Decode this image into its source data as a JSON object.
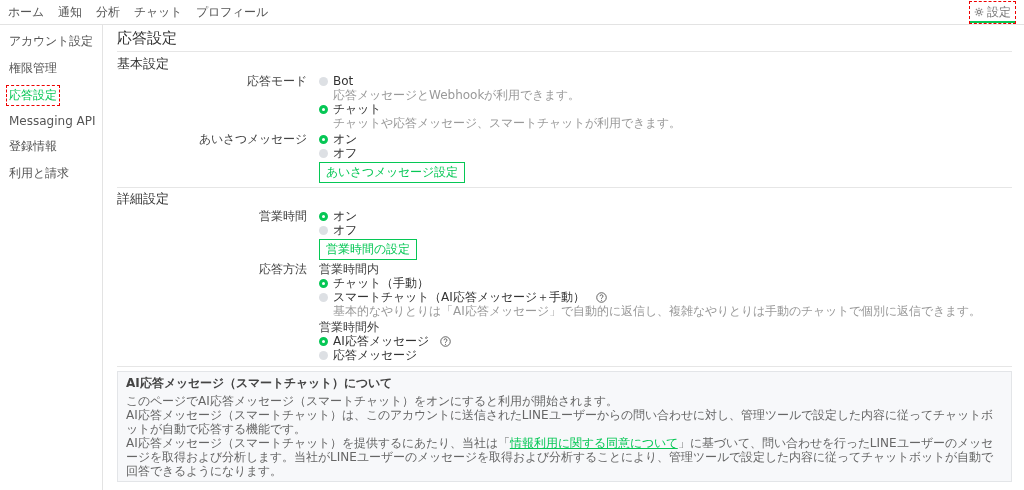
{
  "nav": {
    "items": [
      {
        "label": "ホーム",
        "selected": false
      },
      {
        "label": "通知",
        "selected": false
      },
      {
        "label": "分析",
        "selected": false
      },
      {
        "label": "チャット",
        "selected": false
      },
      {
        "label": "プロフィール",
        "selected": false
      }
    ],
    "settings": {
      "label": "設定",
      "selected": true,
      "annotated": true
    }
  },
  "sidebar": {
    "items": [
      {
        "label": "アカウント設定",
        "selected": false,
        "annotated": false
      },
      {
        "label": "権限管理",
        "selected": false,
        "annotated": false
      },
      {
        "label": "応答設定",
        "selected": true,
        "annotated": true
      },
      {
        "label": "Messaging API",
        "selected": false,
        "annotated": false
      },
      {
        "label": "登録情報",
        "selected": false,
        "annotated": false
      },
      {
        "label": "利用と請求",
        "selected": false,
        "annotated": false
      }
    ]
  },
  "page_title": "応答設定",
  "sections": [
    {
      "title": "基本設定",
      "fields": [
        {
          "label": "応答モード",
          "groups": [
            {
              "options": [
                {
                  "label": "Bot",
                  "description": "応答メッセージとWebhookが利用できます。",
                  "selected": false,
                  "help": false
                },
                {
                  "label": "チャット",
                  "description": "チャットや応答メッセージ、スマートチャットが利用できます。",
                  "selected": true,
                  "help": false
                }
              ]
            }
          ]
        },
        {
          "label": "あいさつメッセージ",
          "groups": [
            {
              "options": [
                {
                  "label": "オン",
                  "selected": true,
                  "help": false
                },
                {
                  "label": "オフ",
                  "selected": false,
                  "help": false
                }
              ],
              "button": "あいさつメッセージ設定"
            }
          ]
        }
      ]
    },
    {
      "title": "詳細設定",
      "fields": [
        {
          "label": "営業時間",
          "groups": [
            {
              "options": [
                {
                  "label": "オン",
                  "selected": true,
                  "help": false
                },
                {
                  "label": "オフ",
                  "selected": false,
                  "help": false
                }
              ],
              "button": "営業時間の設定"
            }
          ]
        },
        {
          "label": "応答方法",
          "groups": [
            {
              "subtitle": "営業時間内",
              "options": [
                {
                  "label": "チャット（手動）",
                  "selected": true,
                  "help": false
                },
                {
                  "label": "スマートチャット（AI応答メッセージ＋手動）",
                  "description": "基本的なやりとりは「AI応答メッセージ」で自動的に返信し、複雑なやりとりは手動のチャットで個別に返信できます。",
                  "selected": false,
                  "help": true
                }
              ]
            },
            {
              "subtitle": "営業時間外",
              "options": [
                {
                  "label": "AI応答メッセージ",
                  "selected": true,
                  "help": true
                },
                {
                  "label": "応答メッセージ",
                  "selected": false,
                  "help": false
                }
              ]
            }
          ]
        }
      ]
    }
  ],
  "info": {
    "title": "AI応答メッセージ（スマートチャット）について",
    "paragraphs": [
      {
        "text": "このページでAI応答メッセージ（スマートチャット）をオンにすると利用が開始されます。"
      },
      {
        "text": "AI応答メッセージ（スマートチャット）は、このアカウントに送信されたLINEユーザーからの問い合わせに対し、管理ツールで設定した内容に従ってチャットボットが自動で応答する機能です。"
      },
      {
        "text": "AI応答メッセージ（スマートチャット）を提供するにあたり、当社は「",
        "link": "情報利用に関する同意について",
        "after": "」に基づいて、問い合わせを行ったLINEユーザーのメッセージを取得および分析します。当社がLINEユーザーのメッセージを取得および分析することにより、管理ツールで設定した内容に従ってチャットボットが自動で回答できるようになります。"
      }
    ]
  }
}
